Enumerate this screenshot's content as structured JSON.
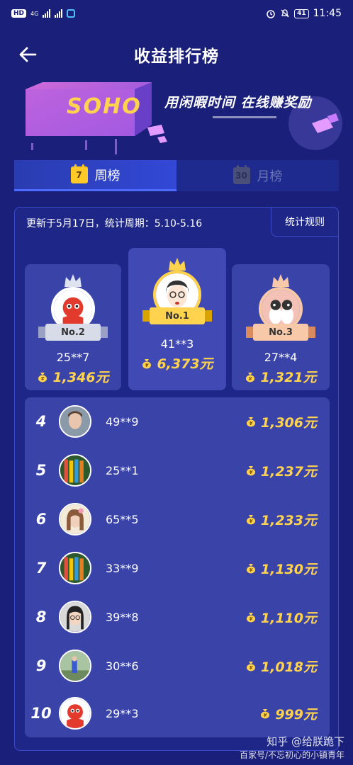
{
  "status_bar": {
    "left_badge": "HD",
    "network": "4G",
    "time": "11:45",
    "battery": "41"
  },
  "header": {
    "title": "收益排行榜",
    "back_icon": "arrow-left-icon"
  },
  "banner": {
    "logo_text": "SOHO",
    "slogan": "用闲暇时间 在线赚奖励"
  },
  "tabs": [
    {
      "label": "周榜",
      "icon_number": "7",
      "selected": true
    },
    {
      "label": "月榜",
      "icon_number": "30",
      "selected": false
    }
  ],
  "panel": {
    "update_text": "更新于5月17日，统计周期：5.10-5.16",
    "rules_label": "统计规则"
  },
  "podium": [
    {
      "rank_label": "No.2",
      "user_id": "25**7",
      "amount": "1,346元"
    },
    {
      "rank_label": "No.1",
      "user_id": "41**3",
      "amount": "6,373元"
    },
    {
      "rank_label": "No.3",
      "user_id": "27**4",
      "amount": "1,321元"
    }
  ],
  "ranking": [
    {
      "rank": "4",
      "user_id": "49**9",
      "amount": "1,306元"
    },
    {
      "rank": "5",
      "user_id": "25**1",
      "amount": "1,237元"
    },
    {
      "rank": "6",
      "user_id": "65**5",
      "amount": "1,233元"
    },
    {
      "rank": "7",
      "user_id": "33**9",
      "amount": "1,130元"
    },
    {
      "rank": "8",
      "user_id": "39**8",
      "amount": "1,110元"
    },
    {
      "rank": "9",
      "user_id": "30**6",
      "amount": "1,018元"
    },
    {
      "rank": "10",
      "user_id": "29**3",
      "amount": "999元"
    }
  ],
  "watermark": {
    "line1": "知乎 @给朕跪下",
    "line2": "百家号/不忘初心的小镇青年"
  },
  "colors": {
    "background": "#1a1f7a",
    "card": "#3a43a8",
    "gold": "#ffd34d",
    "tab_active": "#3248d6"
  }
}
